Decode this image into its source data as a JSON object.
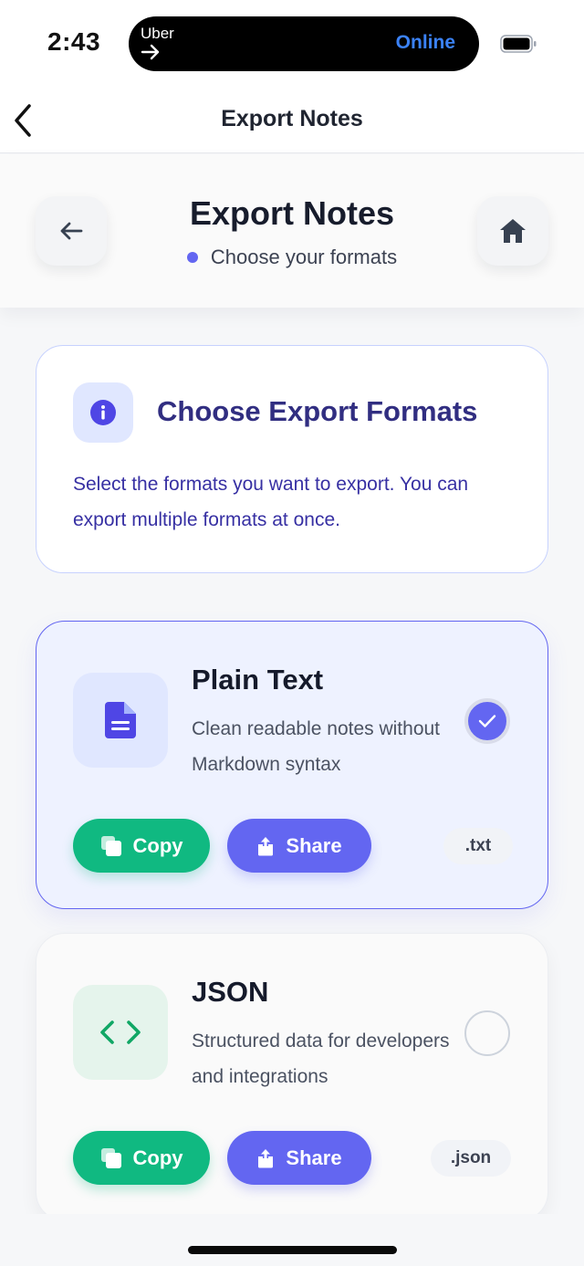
{
  "status_bar": {
    "time": "2:43",
    "island_app": "Uber",
    "island_status": "Online",
    "island_status_color": "#3b82f6"
  },
  "nav": {
    "title": "Export Notes",
    "back_icon": "chevron-left-icon"
  },
  "header": {
    "title": "Export Notes",
    "subtitle": "Choose your formats",
    "left_icon": "arrow-left-icon",
    "right_icon": "home-icon"
  },
  "info_card": {
    "title": "Choose Export Formats",
    "text": "Select the formats you want to export. You can export multiple formats at once.",
    "icon": "info-icon"
  },
  "formats": [
    {
      "name": "Plain Text",
      "description": "Clean readable notes without Markdown syntax",
      "extension": ".txt",
      "selected": true,
      "icon": "document-icon",
      "copy_label": "Copy",
      "share_label": "Share"
    },
    {
      "name": "JSON",
      "description": "Structured data for developers and integrations",
      "extension": ".json",
      "selected": false,
      "icon": "code-icon",
      "copy_label": "Copy",
      "share_label": "Share"
    }
  ],
  "colors": {
    "accent": "#6366f1",
    "copy_green": "#10b981",
    "info_text": "#312e81"
  }
}
